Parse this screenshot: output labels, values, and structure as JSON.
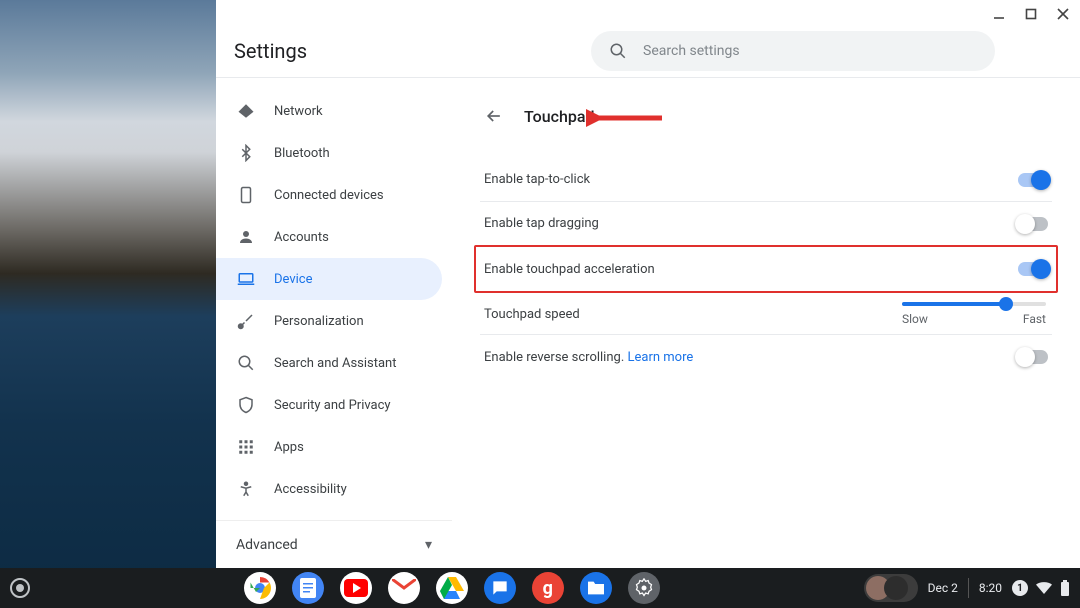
{
  "window_controls": {
    "minimize": "minimize",
    "maximize": "maximize",
    "close": "close"
  },
  "header": {
    "title": "Settings"
  },
  "search": {
    "placeholder": "Search settings"
  },
  "sidebar": {
    "items": [
      {
        "label": "Network",
        "icon": "network"
      },
      {
        "label": "Bluetooth",
        "icon": "bluetooth"
      },
      {
        "label": "Connected devices",
        "icon": "devices"
      },
      {
        "label": "Accounts",
        "icon": "account"
      },
      {
        "label": "Device",
        "icon": "laptop",
        "active": true
      },
      {
        "label": "Personalization",
        "icon": "brush"
      },
      {
        "label": "Search and Assistant",
        "icon": "search"
      },
      {
        "label": "Security and Privacy",
        "icon": "shield"
      },
      {
        "label": "Apps",
        "icon": "apps"
      },
      {
        "label": "Accessibility",
        "icon": "accessibility"
      }
    ],
    "advanced_label": "Advanced"
  },
  "page": {
    "title": "Touchpad",
    "rows": {
      "tap_to_click": {
        "label": "Enable tap-to-click",
        "value": true
      },
      "tap_dragging": {
        "label": "Enable tap dragging",
        "value": false
      },
      "acceleration": {
        "label": "Enable touchpad acceleration",
        "value": true,
        "highlighted": true
      },
      "speed": {
        "label": "Touchpad speed",
        "value": 0.72,
        "min_label": "Slow",
        "max_label": "Fast"
      },
      "reverse": {
        "label": "Enable reverse scrolling. ",
        "learn_more": "Learn more",
        "value": false
      }
    }
  },
  "shelf": {
    "date": "Dec 2",
    "time": "8:20",
    "notification_count": "1",
    "apps": [
      "chrome",
      "docs",
      "youtube",
      "gmail",
      "drive",
      "messages",
      "google",
      "files",
      "settings"
    ]
  }
}
